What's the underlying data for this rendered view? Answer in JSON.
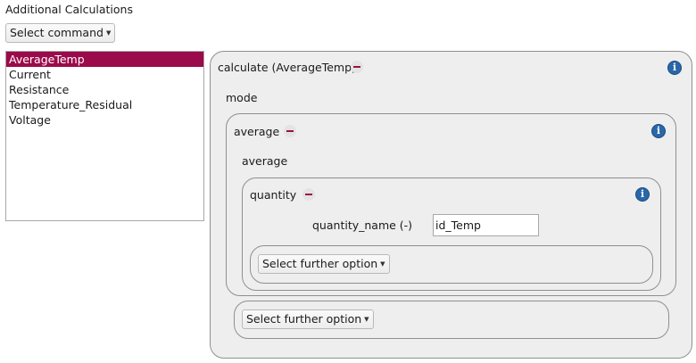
{
  "title": "Additional Calculations",
  "command_dropdown": {
    "label": "Select command"
  },
  "command_list": {
    "items": [
      "AverageTemp",
      "Current",
      "Resistance",
      "Temperature_Residual",
      "Voltage"
    ],
    "selected_index": 0
  },
  "calculate_block": {
    "label": "calculate (AverageTemp)",
    "mode_label": "mode",
    "average_block": {
      "label": "average",
      "sub_label": "average",
      "quantity_block": {
        "label": "quantity",
        "field_label": "quantity_name (-)",
        "field_value": "id_Temp",
        "further_option_label": "Select further option"
      },
      "further_option_label": "Select further option"
    }
  },
  "icons": {
    "info": "info-icon",
    "remove": "minus-icon",
    "caret": "chevron-down-icon",
    "info_glyph": "i"
  },
  "colors": {
    "selection": "#9b0a4a",
    "minus": "#a0103f",
    "info": "#2a67a8",
    "panel_bg": "#eeeeee"
  }
}
